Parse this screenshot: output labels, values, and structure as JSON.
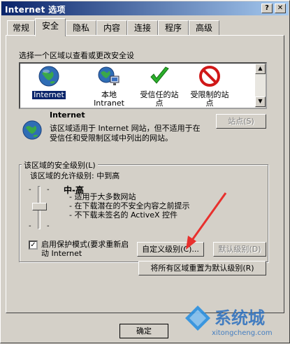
{
  "window": {
    "title": "Internet 选项",
    "help_btn": "?",
    "close_btn": "✕"
  },
  "tabs": [
    "常规",
    "安全",
    "隐私",
    "内容",
    "连接",
    "程序",
    "高级"
  ],
  "active_tab": "安全",
  "zone_prompt": "选择一个区域以查看或更改安全设",
  "zones": [
    {
      "label": "Internet",
      "icon": "globe-icon"
    },
    {
      "label": "本地 Intranet",
      "icon": "network-globe-icon"
    },
    {
      "label": "受信任的站点",
      "icon": "checkmark-icon"
    },
    {
      "label": "受限制的站点",
      "icon": "no-entry-icon"
    }
  ],
  "selected_zone": "Internet",
  "zone_info": {
    "title": "Internet",
    "description": "该区域适用于 Internet 网站，但不适用于在受信任和受限制区域中列出的网站。",
    "sites_button": "站点(S)"
  },
  "security_group": {
    "legend": "该区域的安全级别(L)",
    "allowed_levels": "该区域的允许级别: 中到高",
    "level_name": "中-高",
    "bullets": [
      "- 适用于大多数网站",
      "- 在下载潜在的不安全内容之前提示",
      "- 不下载未签名的 ActiveX 控件"
    ],
    "protected_mode_label": "启用保护模式(要求重新启动 Internet",
    "protected_mode_checked": true,
    "custom_level_button": "自定义级别(C)...",
    "default_level_button": "默认级别(D)"
  },
  "reset_all_button": "将所有区域重置为默认级别(R)",
  "ok_button": "确定",
  "watermark": {
    "brand": "系统城",
    "url": "xitongcheng.com"
  },
  "colors": {
    "titlebar_start": "#0a246a",
    "titlebar_end": "#a6caf0",
    "arrow": "#e8302d"
  }
}
